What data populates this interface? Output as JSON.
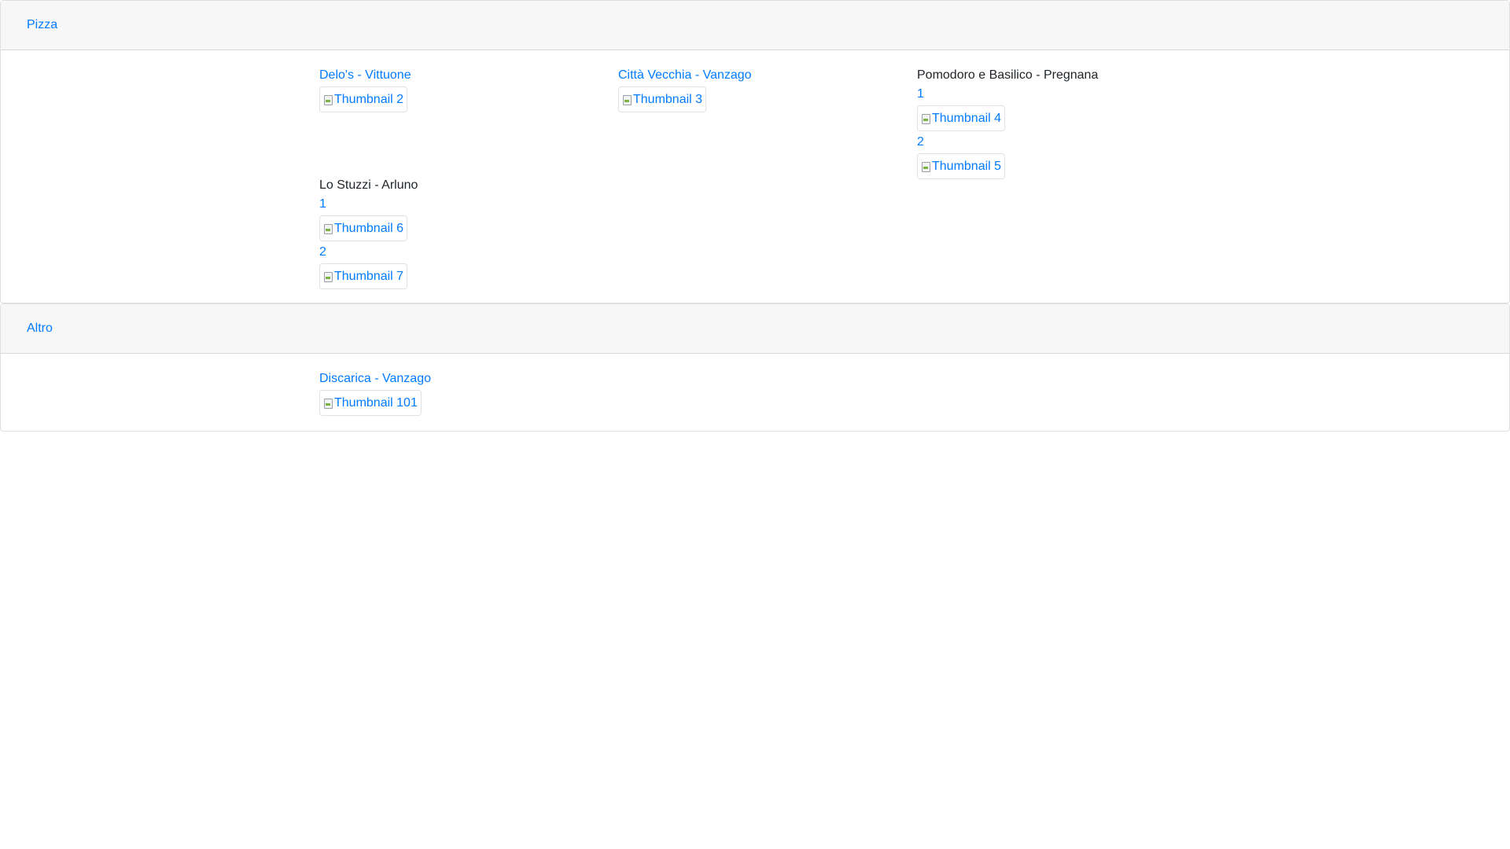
{
  "sections": [
    {
      "title": "Pizza",
      "entries": [
        {
          "title": "Delo's - Vittuone",
          "title_is_link": true,
          "thumbs": [
            {
              "label": "Thumbnail 2"
            }
          ]
        },
        {
          "title": "Città Vecchia - Vanzago",
          "title_is_link": true,
          "thumbs": [
            {
              "label": "Thumbnail 3"
            }
          ]
        },
        {
          "title": "Pomodoro e Basilico - Pregnana",
          "title_is_link": false,
          "thumbs": [
            {
              "num": "1",
              "label": "Thumbnail 4"
            },
            {
              "num": "2",
              "label": "Thumbnail 5"
            }
          ]
        },
        {
          "title": "Lo Stuzzi - Arluno",
          "title_is_link": false,
          "thumbs": [
            {
              "num": "1",
              "label": "Thumbnail 6"
            },
            {
              "num": "2",
              "label": "Thumbnail 7"
            }
          ]
        }
      ]
    },
    {
      "title": "Altro",
      "entries": [
        {
          "title": "Discarica - Vanzago",
          "title_is_link": true,
          "thumbs": [
            {
              "label": "Thumbnail 101"
            }
          ]
        }
      ]
    }
  ],
  "colors": {
    "link": "#007bff",
    "text": "#212529",
    "header_bg": "#f7f7f7"
  },
  "icons": {
    "thumbnail": "broken-image-icon"
  }
}
